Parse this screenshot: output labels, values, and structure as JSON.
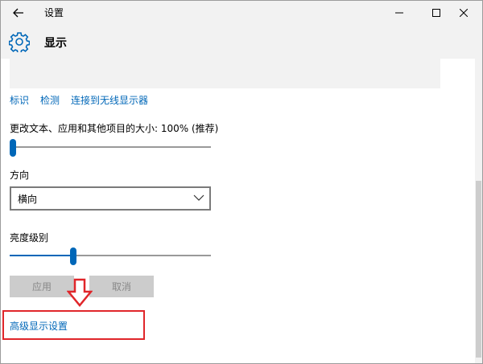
{
  "window": {
    "title": "设置",
    "back_icon": "back-arrow-icon",
    "minimize_icon": "minimize-icon",
    "maximize_icon": "maximize-icon",
    "close_icon": "close-icon"
  },
  "header": {
    "icon": "gear-icon",
    "title": "显示"
  },
  "links": {
    "identify": "标识",
    "detect": "检测",
    "wireless": "连接到无线显示器"
  },
  "scale": {
    "label": "更改文本、应用和其他项目的大小: 100% (推荐)",
    "value_fraction": 0.0
  },
  "orientation": {
    "label": "方向",
    "selected": "横向"
  },
  "brightness": {
    "label": "亮度级别",
    "value_fraction": 0.31
  },
  "buttons": {
    "apply": "应用",
    "cancel": "取消"
  },
  "advanced_link": "高级显示设置",
  "colors": {
    "accent": "#0067b8",
    "annotation_red": "#e0262a"
  }
}
